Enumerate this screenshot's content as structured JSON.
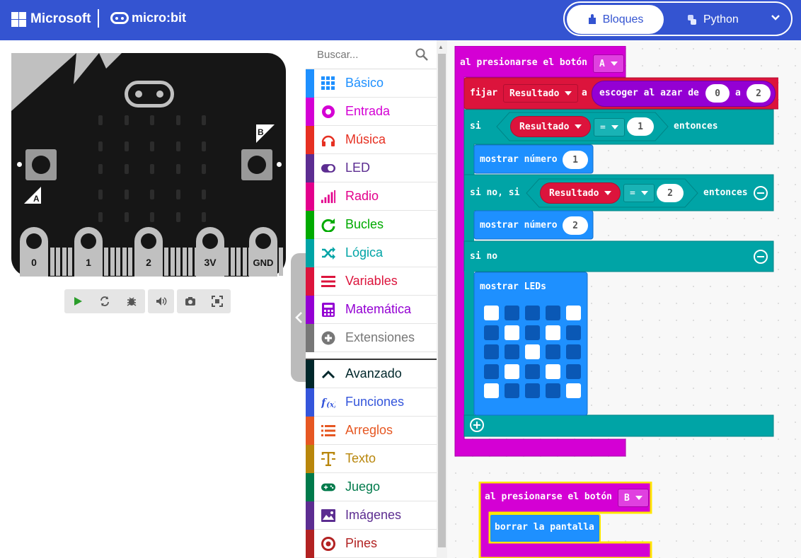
{
  "header": {
    "ms_label": "Microsoft",
    "mb_label": "micro:bit",
    "tab_blocks": "Bloques",
    "tab_python": "Python",
    "colors": {
      "bar": "#3454d1",
      "active_tab_bg": "#ffffff"
    }
  },
  "simulator": {
    "button_a": "A",
    "button_b": "B",
    "pins": [
      "0",
      "1",
      "2",
      "3V",
      "GND"
    ],
    "controls": [
      "play-icon",
      "restart-icon",
      "debug-icon",
      "sound-icon",
      "screenshot-icon",
      "fullscreen-icon"
    ]
  },
  "toolbox": {
    "search_placeholder": "Buscar...",
    "categories": [
      {
        "label": "Básico",
        "color": "#1e90ff",
        "icon": "grid-icon"
      },
      {
        "label": "Entrada",
        "color": "#d400d4",
        "icon": "target-icon"
      },
      {
        "label": "Música",
        "color": "#e63022",
        "icon": "headphones-icon"
      },
      {
        "label": "LED",
        "color": "#5c2d91",
        "icon": "toggle-icon"
      },
      {
        "label": "Radio",
        "color": "#e3008c",
        "icon": "signal-icon"
      },
      {
        "label": "Bucles",
        "color": "#00aa00",
        "icon": "refresh-icon"
      },
      {
        "label": "Lógica",
        "color": "#00a4a6",
        "icon": "shuffle-icon"
      },
      {
        "label": "Variables",
        "color": "#dc143c",
        "icon": "lines-icon"
      },
      {
        "label": "Matemática",
        "color": "#9400d3",
        "icon": "calculator-icon"
      },
      {
        "label": "Extensiones",
        "color": "#777777",
        "icon": "plus-circle-icon"
      },
      {
        "label": "Avanzado",
        "color": "#00272b",
        "icon": "chevron-up-icon"
      },
      {
        "label": "Funciones",
        "color": "#3455db",
        "icon": "function-icon"
      },
      {
        "label": "Arreglos",
        "color": "#e65722",
        "icon": "list-icon"
      },
      {
        "label": "Texto",
        "color": "#b8860b",
        "icon": "text-icon"
      },
      {
        "label": "Juego",
        "color": "#007a4b",
        "icon": "gamepad-icon"
      },
      {
        "label": "Imágenes",
        "color": "#5c2d91",
        "icon": "image-icon"
      },
      {
        "label": "Pines",
        "color": "#b22222",
        "icon": "pin-icon"
      }
    ]
  },
  "workspace": {
    "event_a": {
      "label": "al presionarse el botón",
      "button": "A"
    },
    "set_stmt": {
      "fijar": "fijar",
      "variable": "Resultado",
      "a": "a",
      "random": "escoger al azar de",
      "from": "0",
      "to_word": "a",
      "to": "2"
    },
    "if1": {
      "si": "si",
      "variable": "Resultado",
      "op": "=",
      "value": "1",
      "then": "entonces"
    },
    "show1": {
      "label": "mostrar número",
      "value": "1"
    },
    "elif": {
      "label": "si no, si",
      "variable": "Resultado",
      "op": "=",
      "value": "2",
      "then": "entonces"
    },
    "show2": {
      "label": "mostrar número",
      "value": "2"
    },
    "else": {
      "label": "si no"
    },
    "leds": {
      "label": "mostrar LEDs",
      "grid": [
        [
          1,
          0,
          0,
          0,
          1
        ],
        [
          0,
          1,
          0,
          1,
          0
        ],
        [
          0,
          0,
          1,
          0,
          0
        ],
        [
          0,
          1,
          0,
          1,
          0
        ],
        [
          1,
          0,
          0,
          0,
          1
        ]
      ]
    },
    "event_b": {
      "label": "al presionarse el botón",
      "button": "B"
    },
    "clear": {
      "label": "borrar la pantalla"
    },
    "colors": {
      "event": "#d400d4",
      "variables": "#dc143c",
      "logic": "#00a4a6",
      "basic": "#1e90ff",
      "math": "#9400d3"
    }
  }
}
